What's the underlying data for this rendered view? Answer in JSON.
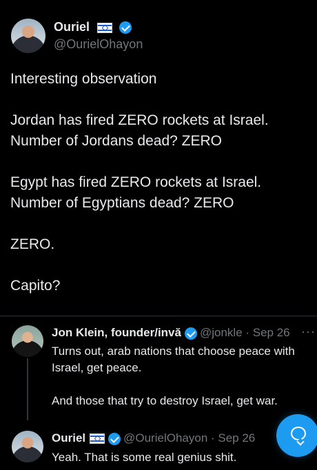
{
  "main_tweet": {
    "author_name": "Ouriel",
    "author_handle": "@OurielOhayon",
    "lines": [
      "Interesting observation",
      "",
      "Jordan has fired ZERO rockets at Israel.",
      "Number of Jordans dead? ZERO",
      "",
      "Egypt has fired ZERO rockets at Israel.",
      "Number of Egyptians dead? ZERO",
      "",
      "ZERO.",
      "",
      "Capito?"
    ]
  },
  "replies": [
    {
      "author_name": "Jon Klein, founder/invă",
      "handle_time": "@jonkle · Sep 26",
      "more": "···",
      "lines": [
        "Turns out, arab nations that choose peace with",
        "Israel, get peace.",
        "",
        "And those that try to destroy Israel, get war."
      ]
    },
    {
      "author_name": "Ouriel",
      "handle_time": "@OurielOhayon · Sep 26",
      "lines": [
        "Yeah. That is some real genius shit."
      ]
    }
  ],
  "colors": {
    "accent": "#1d9bf0",
    "text": "#e7e9ea",
    "muted": "#71767b",
    "background": "#000000"
  },
  "icons": [
    "israel-flag-icon",
    "verified-badge-icon",
    "more-icon",
    "chat-icon"
  ]
}
